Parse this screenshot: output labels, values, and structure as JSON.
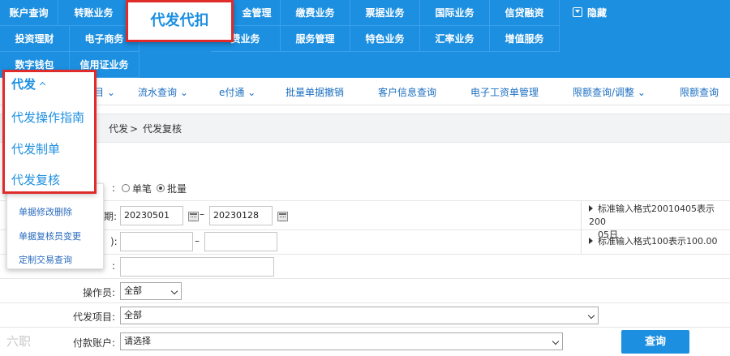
{
  "top_nav": {
    "row1": [
      "账户查询",
      "转账业务",
      "金管理",
      "缴费业务",
      "票据业务",
      "国际业务",
      "信贷融资"
    ],
    "row2": [
      "投资理财",
      "电子商务",
      "费业务",
      "服务管理",
      "特色业务",
      "汇率业务",
      "增值服务"
    ],
    "row3": [
      "数字钱包",
      "信用证业务"
    ],
    "hide_label": "隐藏"
  },
  "popup_menu": {
    "label": "代发代扣"
  },
  "sub_nav": [
    "流水查询",
    "e付通",
    "批量单据撤销",
    "客户信息查询",
    "电子工资单管理",
    "限额查询/调整",
    "限额查询"
  ],
  "left_menu": {
    "header": "代发",
    "items": [
      "代发操作指南",
      "代发制单",
      "代发复核"
    ],
    "extra_items": [
      "单据修改删除",
      "单据复核员变更",
      "定制交易查询"
    ]
  },
  "breadcrumb": {
    "parent": "代发",
    "separator": ">",
    "current": "代发复核"
  },
  "form": {
    "radio_single": "单笔",
    "radio_batch": "批量",
    "date_from": "20230501",
    "date_to": "20230128",
    "date_dash": "–",
    "amount_dash": "–",
    "date_hint_line1": "标准输入格式20010405表示200",
    "date_hint_line2": "05日",
    "amount_hint": "标准输入格式100表示100.00",
    "operator_label": "操作员:",
    "operator_value": "全部",
    "project_label": "代发项目:",
    "project_value": "全部",
    "account_label": "付款账户:",
    "account_value": "请选择",
    "query_button": "查询"
  },
  "watermark": "六职"
}
